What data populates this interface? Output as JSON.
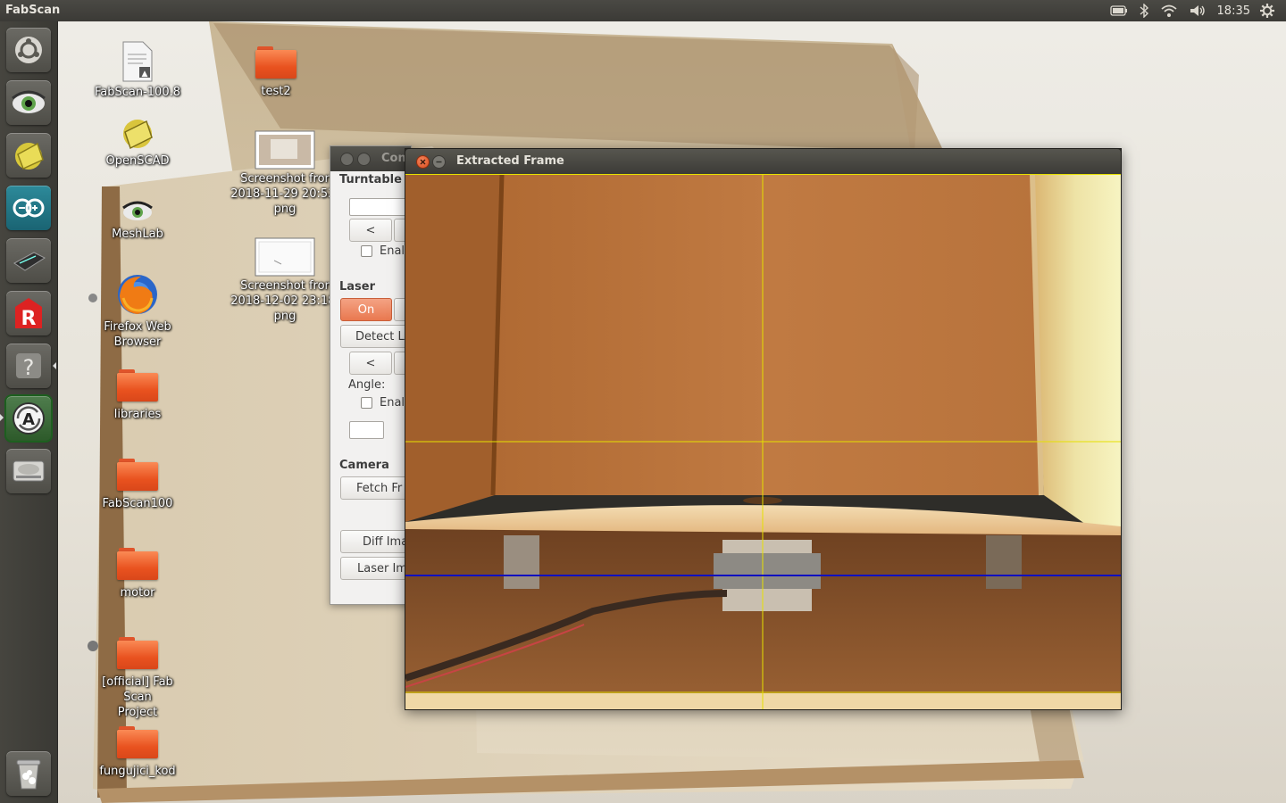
{
  "top_panel": {
    "app_title": "FabScan",
    "clock": "18:35",
    "tray_icons": [
      "battery-icon",
      "bluetooth-icon",
      "wifi-icon",
      "volume-icon",
      "gear-icon"
    ]
  },
  "launcher": {
    "items": [
      {
        "name": "ubuntu-dash-icon"
      },
      {
        "name": "meshlab-eye-icon"
      },
      {
        "name": "openscad-icon"
      },
      {
        "name": "arduino-icon"
      },
      {
        "name": "scanner-icon"
      },
      {
        "name": "red-r-icon"
      },
      {
        "name": "help-icon"
      },
      {
        "name": "software-updater-icon",
        "active": true
      },
      {
        "name": "disk-drive-icon"
      },
      {
        "name": "trash-icon"
      }
    ]
  },
  "desktop": {
    "icons": [
      {
        "label": "FabScan-100.8",
        "kind": "file"
      },
      {
        "label": "test2",
        "kind": "folder"
      },
      {
        "label": "OpenSCAD",
        "kind": "app"
      },
      {
        "label": "Screenshot from 2018-11-29 20:52: png",
        "line1": "Screenshot fror",
        "line2": "2018-11-29 20:52:",
        "line3": "png",
        "kind": "thumb"
      },
      {
        "label": "MeshLab",
        "kind": "app"
      },
      {
        "label": "Screenshot from 2018-12-02 23:18: png",
        "line1": "Screenshot fror",
        "line2": "2018-12-02 23:18:",
        "line3": "png",
        "kind": "thumb"
      },
      {
        "label": "Firefox Web Browser",
        "line1": "Firefox Web",
        "line2": "Browser",
        "kind": "app"
      },
      {
        "label": "libraries",
        "kind": "folder"
      },
      {
        "label": "FabScan100",
        "kind": "folder"
      },
      {
        "label": "motor",
        "kind": "folder"
      },
      {
        "label": "[official] Fab Scan Project",
        "line1": "[official] Fab Scan",
        "line2": "Project",
        "kind": "folder"
      },
      {
        "label": "fungujici_kod",
        "kind": "folder"
      }
    ]
  },
  "control_window": {
    "title": "Con",
    "turntable": {
      "section": "Turntable",
      "prev_button": "<",
      "enable_label": "Enal"
    },
    "laser": {
      "section": "Laser",
      "on_button": "On",
      "detect_button": "Detect L",
      "prev_button": "<",
      "angle_label": "Angle:",
      "enable_label": "Enal"
    },
    "camera": {
      "section": "Camera",
      "fetch_button": "Fetch Fr",
      "diff_button": "Diff Ima",
      "laser_button": "Laser Im"
    }
  },
  "frame_window": {
    "title": "Extracted Frame",
    "crosshair_color": "#e6e000",
    "laser_line_color": "#1010c0"
  },
  "colors": {
    "close_button": "#e2552a",
    "accent_orange": "#f08a5d",
    "panel": "#3c3b37"
  }
}
